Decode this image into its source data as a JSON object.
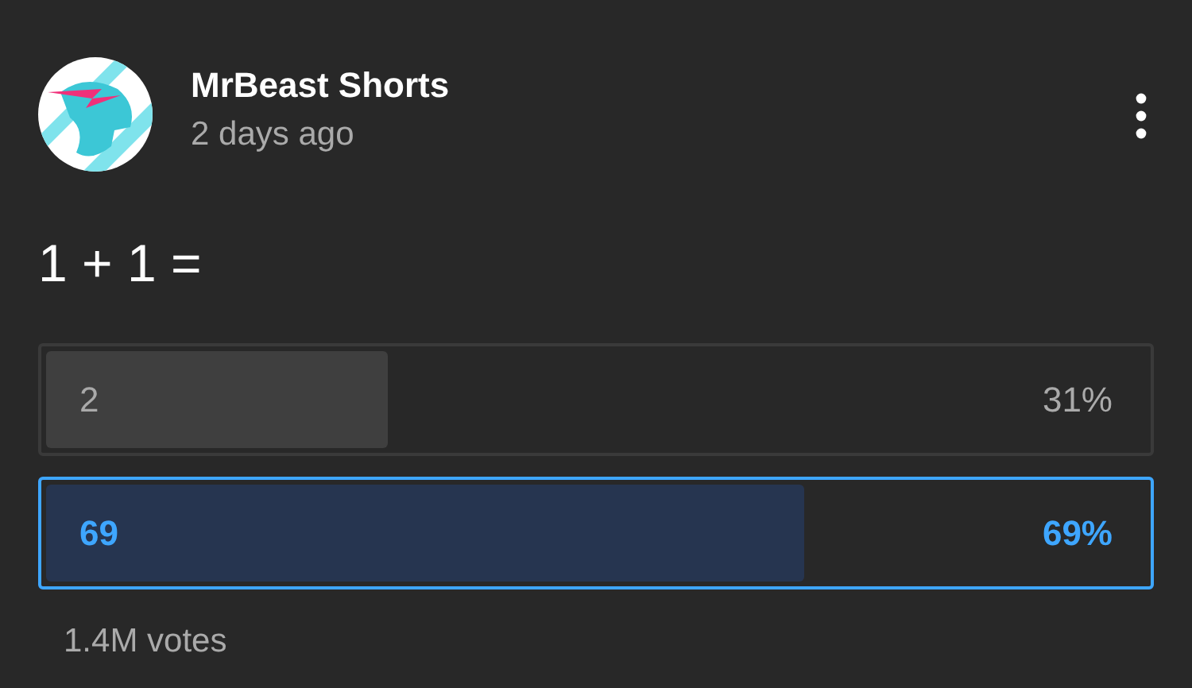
{
  "post": {
    "channel": "MrBeast Shorts",
    "time": "2 days ago",
    "question": "1 + 1 =",
    "options": [
      {
        "label": "2",
        "percent": "31%",
        "level": 0.31,
        "selected": false
      },
      {
        "label": "69",
        "percent": "69%",
        "level": 0.69,
        "selected": true
      }
    ],
    "votes": "1.4M votes"
  }
}
